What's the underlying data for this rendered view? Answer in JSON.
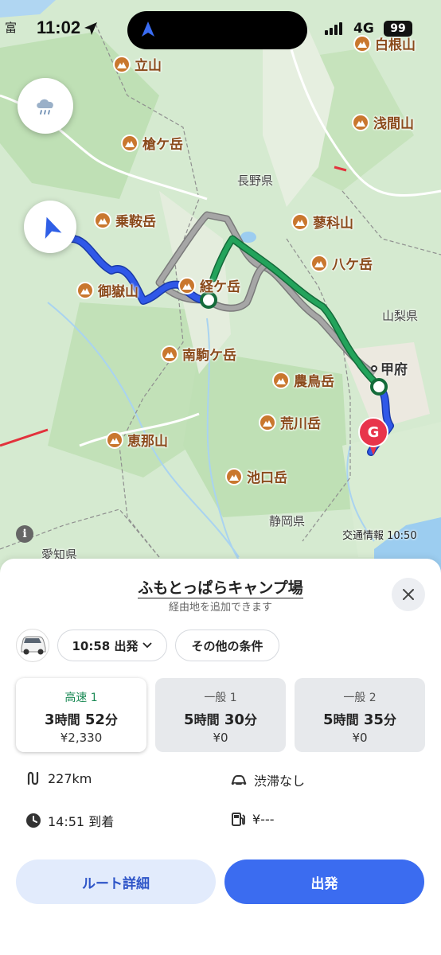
{
  "status": {
    "time": "11:02",
    "network": "4G",
    "battery": "99",
    "corner_label": "富"
  },
  "map": {
    "mountains": [
      "立山",
      "白根山",
      "浅間山",
      "槍ケ岳",
      "乗鞍岳",
      "蓼科山",
      "八ケ岳",
      "御嶽山",
      "経ケ岳",
      "南駒ケ岳",
      "農鳥岳",
      "荒川岳",
      "恵那山",
      "池口岳"
    ],
    "prefectures": [
      "長野県",
      "山梨県",
      "静岡県",
      "愛知県"
    ],
    "city": "甲府",
    "goal_label": "G",
    "traffic_info": "交通情報 10:50",
    "info_icon": "i",
    "route_colors": {
      "highway": "#1e8f4e",
      "alt": "#9a9a9a",
      "current": "#3058e8"
    }
  },
  "sheet": {
    "destination": "ふもとっぱらキャンプ場",
    "via_hint": "経由地を追加できます",
    "depart_label": "10:58 出発",
    "conditions_label": "その他の条件",
    "routes": [
      {
        "label": "高速 1",
        "h": "3",
        "h_unit": "時間",
        "m": "52",
        "m_unit": "分",
        "toll": "¥2,330"
      },
      {
        "label": "一般 1",
        "h": "5",
        "h_unit": "時間",
        "m": "30",
        "m_unit": "分",
        "toll": "¥0"
      },
      {
        "label": "一般 2",
        "h": "5",
        "h_unit": "時間",
        "m": "35",
        "m_unit": "分",
        "toll": "¥0"
      }
    ],
    "distance": "227km",
    "congestion": "渋滞なし",
    "arrival": "14:51 到着",
    "fuel": "¥---",
    "detail_button": "ルート詳細",
    "start_button": "出発"
  }
}
